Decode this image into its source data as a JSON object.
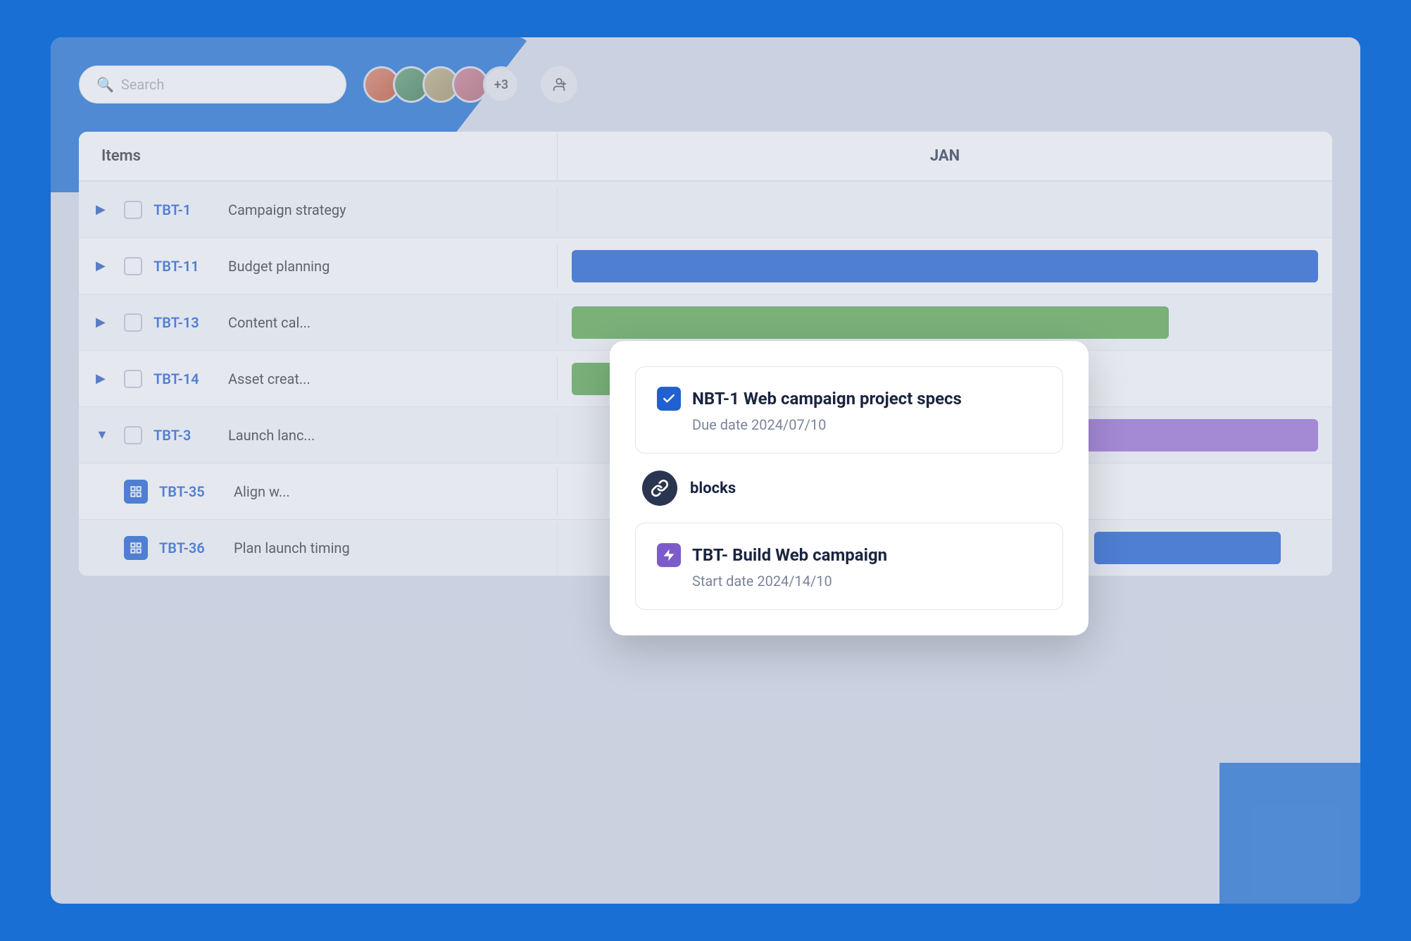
{
  "header": {
    "search_placeholder": "Search",
    "avatar_extra_count": "+3",
    "add_user_label": "+"
  },
  "table": {
    "col_items_label": "Items",
    "col_jan_label": "JAN",
    "rows": [
      {
        "id": "TBT-1",
        "label": "Campaign strategy",
        "type": "parent",
        "has_chevron": true,
        "chevron_direction": "right"
      },
      {
        "id": "TBT-11",
        "label": "Budget planning",
        "type": "parent",
        "has_chevron": true,
        "chevron_direction": "right",
        "bar": "blue"
      },
      {
        "id": "TBT-13",
        "label": "Content cal...",
        "type": "parent",
        "has_chevron": true,
        "chevron_direction": "right",
        "bar": "green"
      },
      {
        "id": "TBT-14",
        "label": "Asset creat...",
        "type": "parent",
        "has_chevron": true,
        "chevron_direction": "right",
        "bar": "green2"
      },
      {
        "id": "TBT-3",
        "label": "Launch lanc...",
        "type": "parent",
        "has_chevron": true,
        "chevron_direction": "down",
        "bar": "purple"
      },
      {
        "id": "TBT-35",
        "label": "Align w...",
        "type": "child",
        "has_chevron": false,
        "bar": "none"
      },
      {
        "id": "TBT-36",
        "label": "Plan launch timing",
        "type": "child",
        "has_chevron": false,
        "bar": "gold-connector"
      }
    ]
  },
  "popup": {
    "task1": {
      "title": "NBT-1 Web campaign project specs",
      "due_date_label": "Due date 2024/07/10"
    },
    "connector_label": "blocks",
    "task2": {
      "title": "TBT- Build Web campaign",
      "start_date_label": "Start date 2024/14/10"
    }
  }
}
